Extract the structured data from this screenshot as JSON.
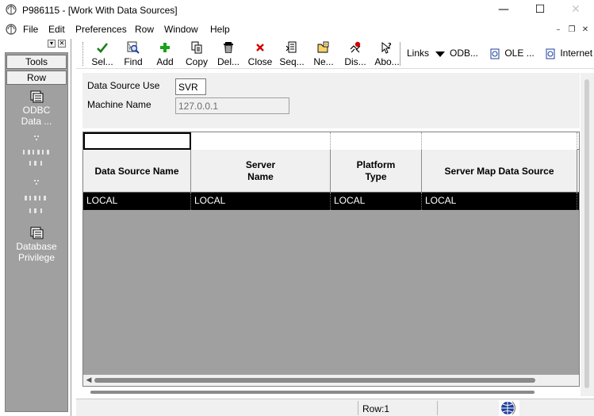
{
  "window": {
    "title": "P986115 - [Work With Data Sources]",
    "minimize_glyph": "—",
    "maximize_glyph": "☐",
    "close_glyph": "✕"
  },
  "menu": {
    "items": [
      "File",
      "Edit",
      "Preferences",
      "Row",
      "Window",
      "Help"
    ],
    "mdi_minimize": "–",
    "mdi_restore": "❐",
    "mdi_close": "✕"
  },
  "left_panel": {
    "pin_glyph": "▾",
    "close_glyph": "✕",
    "tools_label": "Tools",
    "row_label": "Row",
    "items": [
      {
        "label": "ODBC Data ...",
        "icon": "list-icon",
        "enabled": true
      },
      {
        "label": "",
        "icon": "list-icon",
        "enabled": false
      },
      {
        "label": "",
        "icon": "list-icon",
        "enabled": false
      },
      {
        "label": "Database Privilege",
        "icon": "list-icon",
        "enabled": true
      }
    ]
  },
  "toolbar": {
    "buttons": [
      {
        "label": "Sel...",
        "icon": "checkmark-icon",
        "color": "#1a7f1a"
      },
      {
        "label": "Find",
        "icon": "find-icon",
        "color": "#1f3f99"
      },
      {
        "label": "Add",
        "icon": "plus-icon",
        "color": "#1aa31a"
      },
      {
        "label": "Copy",
        "icon": "copy-icon",
        "color": "#000000"
      },
      {
        "label": "Del...",
        "icon": "trash-icon",
        "color": "#000000"
      },
      {
        "label": "Close",
        "icon": "close-x-icon",
        "color": "#d40000"
      },
      {
        "label": "Seq...",
        "icon": "sequence-icon",
        "color": "#000000"
      },
      {
        "label": "Ne...",
        "icon": "new-folder-icon",
        "color": "#e8a800"
      },
      {
        "label": "Dis...",
        "icon": "display-icon",
        "color": "#d40000"
      },
      {
        "label": "Abo...",
        "icon": "help-cursor-icon",
        "color": "#000000"
      }
    ],
    "links": [
      {
        "label": "Links",
        "icon": "dropdown-arrow-icon"
      },
      {
        "label": "ODB...",
        "icon": ""
      },
      {
        "label": "OLE ...",
        "icon": "document-icon"
      },
      {
        "label": "Internet",
        "icon": "document-icon"
      }
    ]
  },
  "form": {
    "data_source_use_label": "Data Source Use",
    "data_source_use_value": "SVR",
    "machine_name_label": "Machine Name",
    "machine_name_value": "127.0.0.1"
  },
  "grid": {
    "columns": [
      {
        "header": "Data Source Name"
      },
      {
        "header": "Server Name"
      },
      {
        "header": "Platform Type"
      },
      {
        "header": "Server Map Data Source"
      }
    ],
    "rows": [
      [
        "LOCAL",
        "LOCAL",
        "LOCAL",
        "LOCAL"
      ]
    ],
    "scroll_left_glyph": "◀"
  },
  "status": {
    "row_text": "Row:1"
  },
  "colors": {
    "grid_background": "#a0a0a0",
    "selected_row": "#000000",
    "panel_background": "#a0a0a0"
  }
}
